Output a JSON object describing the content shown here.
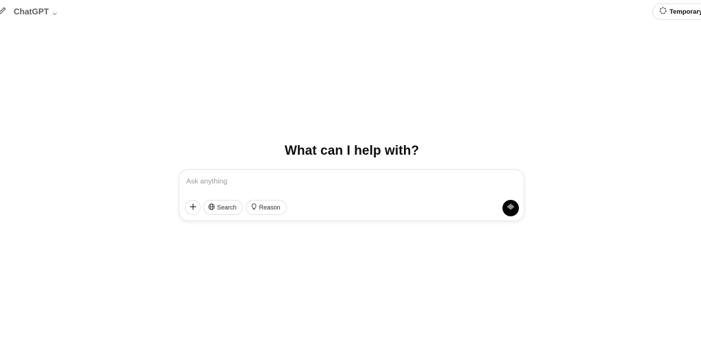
{
  "header": {
    "model_label": "ChatGPT",
    "temporary_label": "Temporary"
  },
  "main": {
    "headline": "What can I help with?"
  },
  "composer": {
    "placeholder": "Ask anything",
    "search_label": "Search",
    "reason_label": "Reason"
  },
  "icons": {
    "new_chat": "edit-pencil-icon",
    "model_chevron": "chevron-down-icon",
    "temporary": "dashed-circle-icon",
    "attach": "plus-icon",
    "search": "globe-icon",
    "reason": "lightbulb-icon",
    "voice": "voice-waveform-icon"
  },
  "colors": {
    "voice_button_bg": "#000000",
    "placeholder_text": "#9b9b9b",
    "border": "#e3e3e3"
  }
}
